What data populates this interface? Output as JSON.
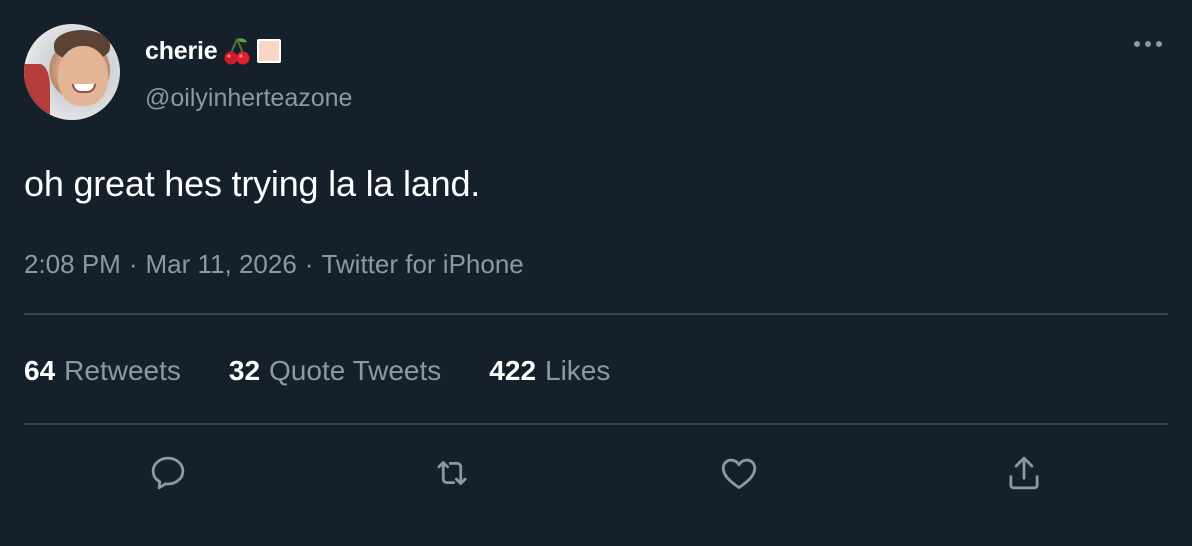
{
  "author": {
    "display_name": "cherie",
    "handle": "@oilyinherteazone",
    "emoji_icons": [
      "cherry-icon",
      "skin-tone-square-icon"
    ]
  },
  "tweet": {
    "text": "oh great hes trying la la land.",
    "time": "2:08 PM",
    "separator": "·",
    "date": "Mar 11, 2026",
    "source": "Twitter for iPhone"
  },
  "stats": {
    "retweets_count": "64",
    "retweets_label": "Retweets",
    "quotes_count": "32",
    "quotes_label": "Quote Tweets",
    "likes_count": "422",
    "likes_label": "Likes"
  },
  "actions": [
    "reply-icon",
    "retweet-icon",
    "like-icon",
    "share-icon"
  ],
  "colors": {
    "background": "#15202b",
    "primary_text": "#ffffff",
    "secondary_text": "#8b98a5",
    "divider": "#38444d"
  }
}
